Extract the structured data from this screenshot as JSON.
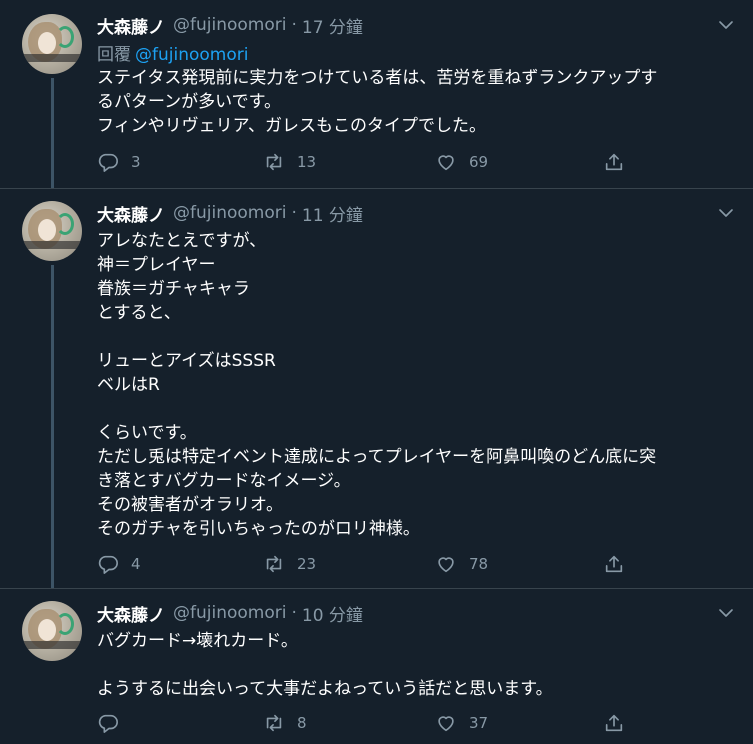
{
  "tweets": [
    {
      "name": "大森藤ノ",
      "handle": "@fujinoomori",
      "separator": "·",
      "time": "17 分鐘",
      "reply_prefix": "回覆",
      "reply_mention": "@fujinoomori",
      "lines": [
        "ステイタス発現前に実力をつけている者は、苦労を重ねずランクアップす",
        "るパターンが多いです。",
        "フィンやリヴェリア、ガレスもこのタイプでした。"
      ],
      "replies": "3",
      "retweets": "13",
      "likes": "69"
    },
    {
      "name": "大森藤ノ",
      "handle": "@fujinoomori",
      "separator": "·",
      "time": "11 分鐘",
      "lines": [
        "アレなたとえですが、",
        "神＝プレイヤー",
        "眷族＝ガチャキャラ",
        "とすると、",
        "",
        "リューとアイズはSSSR",
        "ベルはR",
        "",
        "くらいです。",
        "ただし兎は特定イベント達成によってプレイヤーを阿鼻叫喚のどん底に突",
        "き落とすバグカードなイメージ。",
        "その被害者がオラリオ。",
        "そのガチャを引いちゃったのがロリ神様。"
      ],
      "replies": "4",
      "retweets": "23",
      "likes": "78"
    },
    {
      "name": "大森藤ノ",
      "handle": "@fujinoomori",
      "separator": "·",
      "time": "10 分鐘",
      "lines": [
        "バグカード→壊れカード。",
        "",
        "ようするに出会いって大事だよねっていう話だと思います。"
      ],
      "replies": "",
      "retweets": "8",
      "likes": "37"
    }
  ],
  "colors": {
    "background": "#15202b",
    "secondary_text": "#8899a6",
    "link": "#1da1f2",
    "divider": "#38444d"
  },
  "icons": [
    "avatar-image",
    "chevron-down-icon",
    "reply-icon",
    "retweet-icon",
    "like-icon",
    "share-icon"
  ]
}
